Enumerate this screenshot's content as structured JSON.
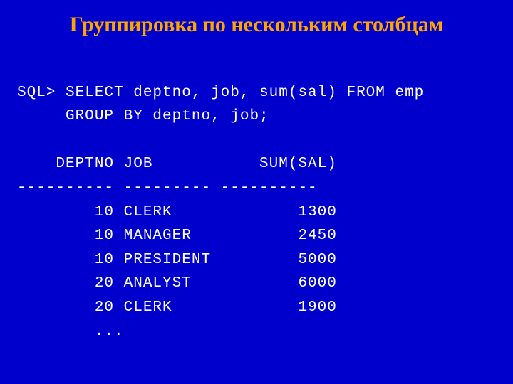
{
  "title": "Группировка по нескольким столбцам",
  "code_lines": {
    "l0": "SQL> SELECT deptno, job, sum(sal) FROM emp",
    "l1": "     GROUP BY deptno, job;",
    "l2": "",
    "l3": "    DEPTNO JOB           SUM(SAL)",
    "l4": "---------- --------- ----------",
    "l5": "        10 CLERK             1300",
    "l6": "        10 MANAGER           2450",
    "l7": "        10 PRESIDENT         5000",
    "l8": "        20 ANALYST           6000",
    "l9": "        20 CLERK             1900",
    "l10": "        ..."
  },
  "chart_data": {
    "type": "table",
    "title": "Группировка по нескольким столбцам",
    "sql": "SELECT deptno, job, sum(sal) FROM emp GROUP BY deptno, job;",
    "columns": [
      "DEPTNO",
      "JOB",
      "SUM(SAL)"
    ],
    "rows": [
      {
        "DEPTNO": 10,
        "JOB": "CLERK",
        "SUM(SAL)": 1300
      },
      {
        "DEPTNO": 10,
        "JOB": "MANAGER",
        "SUM(SAL)": 2450
      },
      {
        "DEPTNO": 10,
        "JOB": "PRESIDENT",
        "SUM(SAL)": 5000
      },
      {
        "DEPTNO": 20,
        "JOB": "ANALYST",
        "SUM(SAL)": 6000
      },
      {
        "DEPTNO": 20,
        "JOB": "CLERK",
        "SUM(SAL)": 1900
      }
    ],
    "truncated": true
  }
}
